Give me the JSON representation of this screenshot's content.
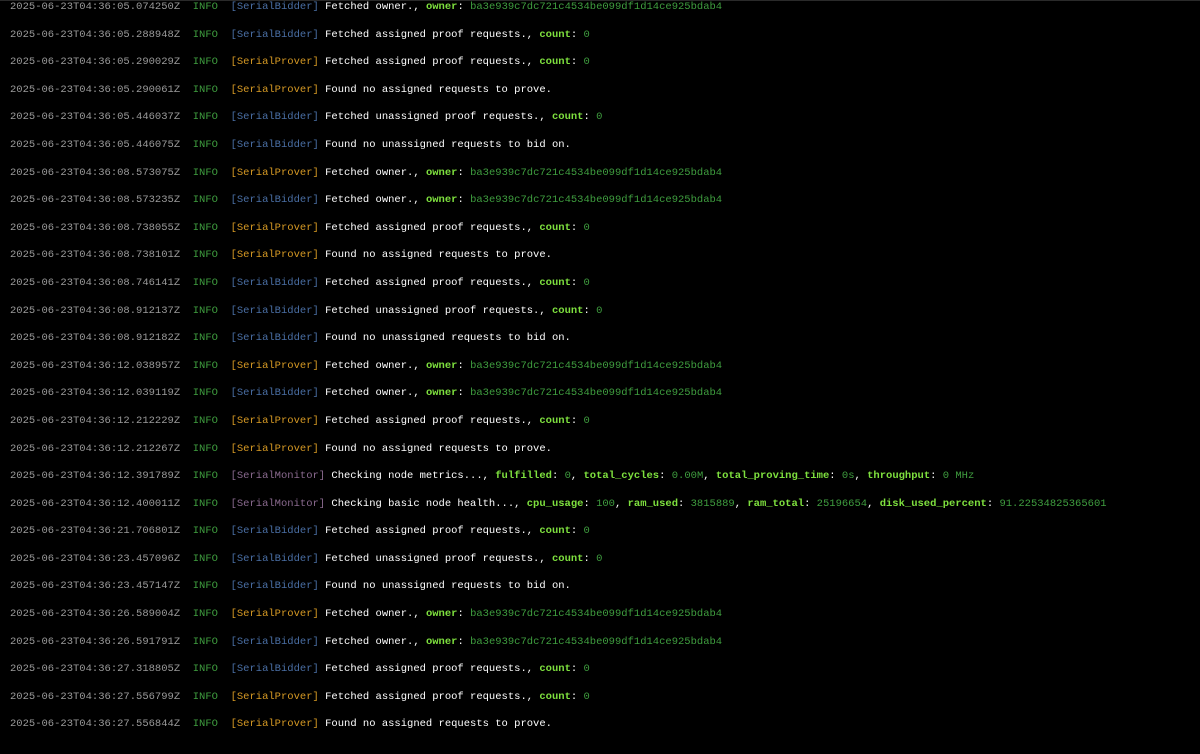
{
  "colors": {
    "background": "#000000",
    "timestamp": "#9a9a9a",
    "level": "#3f9e3f",
    "text": "#ffffff",
    "key": "#7ee03e",
    "value": "#3f9e3f",
    "tag_SerialBidder": "#4a6fa5",
    "tag_SerialProver": "#d79a24",
    "tag_SerialMonitor": "#8a6a8f"
  },
  "logs": [
    {
      "ts": "2025-06-23T04:36:05.074250Z",
      "level": "INFO",
      "tag": "[SerialBidder]",
      "tagColor": "#4a6fa5",
      "msg": "Fetched owner.",
      "fields": [
        {
          "k": "owner",
          "v": "ba3e939c7dc721c4534be099df1d14ce925bdab4"
        }
      ]
    },
    {
      "ts": "2025-06-23T04:36:05.288948Z",
      "level": "INFO",
      "tag": "[SerialBidder]",
      "tagColor": "#4a6fa5",
      "msg": "Fetched assigned proof requests.",
      "fields": [
        {
          "k": "count",
          "v": "0"
        }
      ]
    },
    {
      "ts": "2025-06-23T04:36:05.290029Z",
      "level": "INFO",
      "tag": "[SerialProver]",
      "tagColor": "#d79a24",
      "msg": "Fetched assigned proof requests.",
      "fields": [
        {
          "k": "count",
          "v": "0"
        }
      ]
    },
    {
      "ts": "2025-06-23T04:36:05.290061Z",
      "level": "INFO",
      "tag": "[SerialProver]",
      "tagColor": "#d79a24",
      "msg": "Found no assigned requests to prove.",
      "fields": []
    },
    {
      "ts": "2025-06-23T04:36:05.446037Z",
      "level": "INFO",
      "tag": "[SerialBidder]",
      "tagColor": "#4a6fa5",
      "msg": "Fetched unassigned proof requests.",
      "fields": [
        {
          "k": "count",
          "v": "0"
        }
      ]
    },
    {
      "ts": "2025-06-23T04:36:05.446075Z",
      "level": "INFO",
      "tag": "[SerialBidder]",
      "tagColor": "#4a6fa5",
      "msg": "Found no unassigned requests to bid on.",
      "fields": []
    },
    {
      "ts": "2025-06-23T04:36:08.573075Z",
      "level": "INFO",
      "tag": "[SerialProver]",
      "tagColor": "#d79a24",
      "msg": "Fetched owner.",
      "fields": [
        {
          "k": "owner",
          "v": "ba3e939c7dc721c4534be099df1d14ce925bdab4"
        }
      ]
    },
    {
      "ts": "2025-06-23T04:36:08.573235Z",
      "level": "INFO",
      "tag": "[SerialBidder]",
      "tagColor": "#4a6fa5",
      "msg": "Fetched owner.",
      "fields": [
        {
          "k": "owner",
          "v": "ba3e939c7dc721c4534be099df1d14ce925bdab4"
        }
      ]
    },
    {
      "ts": "2025-06-23T04:36:08.738055Z",
      "level": "INFO",
      "tag": "[SerialProver]",
      "tagColor": "#d79a24",
      "msg": "Fetched assigned proof requests.",
      "fields": [
        {
          "k": "count",
          "v": "0"
        }
      ]
    },
    {
      "ts": "2025-06-23T04:36:08.738101Z",
      "level": "INFO",
      "tag": "[SerialProver]",
      "tagColor": "#d79a24",
      "msg": "Found no assigned requests to prove.",
      "fields": []
    },
    {
      "ts": "2025-06-23T04:36:08.746141Z",
      "level": "INFO",
      "tag": "[SerialBidder]",
      "tagColor": "#4a6fa5",
      "msg": "Fetched assigned proof requests.",
      "fields": [
        {
          "k": "count",
          "v": "0"
        }
      ]
    },
    {
      "ts": "2025-06-23T04:36:08.912137Z",
      "level": "INFO",
      "tag": "[SerialBidder]",
      "tagColor": "#4a6fa5",
      "msg": "Fetched unassigned proof requests.",
      "fields": [
        {
          "k": "count",
          "v": "0"
        }
      ]
    },
    {
      "ts": "2025-06-23T04:36:08.912182Z",
      "level": "INFO",
      "tag": "[SerialBidder]",
      "tagColor": "#4a6fa5",
      "msg": "Found no unassigned requests to bid on.",
      "fields": []
    },
    {
      "ts": "2025-06-23T04:36:12.038957Z",
      "level": "INFO",
      "tag": "[SerialProver]",
      "tagColor": "#d79a24",
      "msg": "Fetched owner.",
      "fields": [
        {
          "k": "owner",
          "v": "ba3e939c7dc721c4534be099df1d14ce925bdab4"
        }
      ]
    },
    {
      "ts": "2025-06-23T04:36:12.039119Z",
      "level": "INFO",
      "tag": "[SerialBidder]",
      "tagColor": "#4a6fa5",
      "msg": "Fetched owner.",
      "fields": [
        {
          "k": "owner",
          "v": "ba3e939c7dc721c4534be099df1d14ce925bdab4"
        }
      ]
    },
    {
      "ts": "2025-06-23T04:36:12.212229Z",
      "level": "INFO",
      "tag": "[SerialProver]",
      "tagColor": "#d79a24",
      "msg": "Fetched assigned proof requests.",
      "fields": [
        {
          "k": "count",
          "v": "0"
        }
      ]
    },
    {
      "ts": "2025-06-23T04:36:12.212267Z",
      "level": "INFO",
      "tag": "[SerialProver]",
      "tagColor": "#d79a24",
      "msg": "Found no assigned requests to prove.",
      "fields": []
    },
    {
      "ts": "2025-06-23T04:36:12.391789Z",
      "level": "INFO",
      "tag": "[SerialMonitor]",
      "tagColor": "#8a6a8f",
      "msg": "Checking node metrics...",
      "fields": [
        {
          "k": "fulfilled",
          "v": "0"
        },
        {
          "k": "total_cycles",
          "v": "0.00M"
        },
        {
          "k": "total_proving_time",
          "v": "0s"
        },
        {
          "k": "throughput",
          "v": "0 MHz"
        }
      ]
    },
    {
      "ts": "2025-06-23T04:36:12.400011Z",
      "level": "INFO",
      "tag": "[SerialMonitor]",
      "tagColor": "#8a6a8f",
      "msg": "Checking basic node health...",
      "fields": [
        {
          "k": "cpu_usage",
          "v": "100"
        },
        {
          "k": "ram_used",
          "v": "3815889"
        },
        {
          "k": "ram_total",
          "v": "25196654"
        },
        {
          "k": "disk_used_percent",
          "v": "91.22534825365601"
        }
      ]
    },
    {
      "ts": "2025-06-23T04:36:21.706801Z",
      "level": "INFO",
      "tag": "[SerialBidder]",
      "tagColor": "#4a6fa5",
      "msg": "Fetched assigned proof requests.",
      "fields": [
        {
          "k": "count",
          "v": "0"
        }
      ]
    },
    {
      "ts": "2025-06-23T04:36:23.457096Z",
      "level": "INFO",
      "tag": "[SerialBidder]",
      "tagColor": "#4a6fa5",
      "msg": "Fetched unassigned proof requests.",
      "fields": [
        {
          "k": "count",
          "v": "0"
        }
      ]
    },
    {
      "ts": "2025-06-23T04:36:23.457147Z",
      "level": "INFO",
      "tag": "[SerialBidder]",
      "tagColor": "#4a6fa5",
      "msg": "Found no unassigned requests to bid on.",
      "fields": []
    },
    {
      "ts": "2025-06-23T04:36:26.589004Z",
      "level": "INFO",
      "tag": "[SerialProver]",
      "tagColor": "#d79a24",
      "msg": "Fetched owner.",
      "fields": [
        {
          "k": "owner",
          "v": "ba3e939c7dc721c4534be099df1d14ce925bdab4"
        }
      ]
    },
    {
      "ts": "2025-06-23T04:36:26.591791Z",
      "level": "INFO",
      "tag": "[SerialBidder]",
      "tagColor": "#4a6fa5",
      "msg": "Fetched owner.",
      "fields": [
        {
          "k": "owner",
          "v": "ba3e939c7dc721c4534be099df1d14ce925bdab4"
        }
      ]
    },
    {
      "ts": "2025-06-23T04:36:27.318805Z",
      "level": "INFO",
      "tag": "[SerialBidder]",
      "tagColor": "#4a6fa5",
      "msg": "Fetched assigned proof requests.",
      "fields": [
        {
          "k": "count",
          "v": "0"
        }
      ]
    },
    {
      "ts": "2025-06-23T04:36:27.556799Z",
      "level": "INFO",
      "tag": "[SerialProver]",
      "tagColor": "#d79a24",
      "msg": "Fetched assigned proof requests.",
      "fields": [
        {
          "k": "count",
          "v": "0"
        }
      ]
    },
    {
      "ts": "2025-06-23T04:36:27.556844Z",
      "level": "INFO",
      "tag": "[SerialProver]",
      "tagColor": "#d79a24",
      "msg": "Found no assigned requests to prove.",
      "fields": []
    }
  ]
}
